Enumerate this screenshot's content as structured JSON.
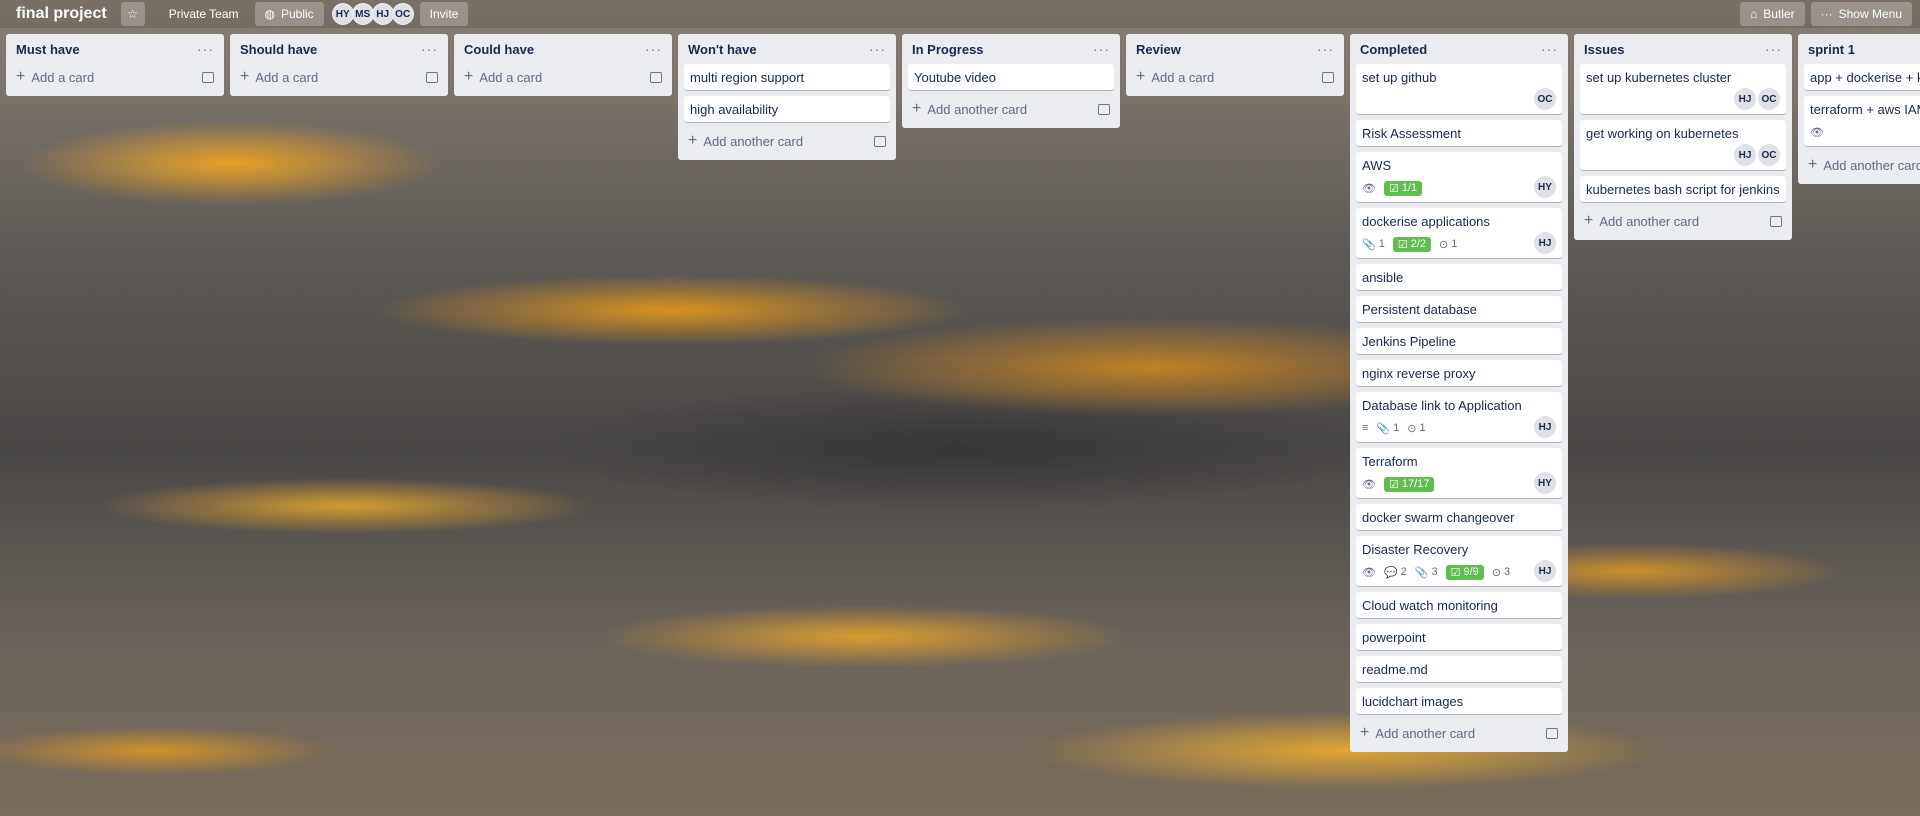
{
  "header": {
    "board_title": "final project",
    "star_icon": "star-icon",
    "team_label": "Private Team",
    "visibility_label": "Public",
    "members": [
      "HY",
      "MS",
      "HJ",
      "OC"
    ],
    "invite_label": "Invite",
    "butler_label": "Butler",
    "show_menu_label": "Show Menu"
  },
  "lists": [
    {
      "title": "Must have",
      "cards": [],
      "add_label": "Add a card"
    },
    {
      "title": "Should have",
      "cards": [],
      "add_label": "Add a card"
    },
    {
      "title": "Could have",
      "cards": [],
      "add_label": "Add a card"
    },
    {
      "title": "Won't have",
      "cards": [
        {
          "title": "multi region support"
        },
        {
          "title": "high availability"
        }
      ],
      "add_label": "Add another card"
    },
    {
      "title": "In Progress",
      "cards": [
        {
          "title": "Youtube video"
        }
      ],
      "add_label": "Add another card"
    },
    {
      "title": "Review",
      "cards": [],
      "add_label": "Add a card"
    },
    {
      "title": "Completed",
      "cards": [
        {
          "title": "set up github",
          "members": [
            "OC"
          ]
        },
        {
          "title": "Risk Assessment"
        },
        {
          "title": "AWS",
          "watch": true,
          "checklist": "1/1",
          "members": [
            "HY"
          ]
        },
        {
          "title": "dockerise applications",
          "attachments": "1",
          "checklist": "2/2",
          "github": "1",
          "members": [
            "HJ"
          ]
        },
        {
          "title": "ansible"
        },
        {
          "title": "Persistent database"
        },
        {
          "title": "Jenkins Pipeline"
        },
        {
          "title": "nginx reverse proxy"
        },
        {
          "title": "Database link to Application",
          "description": true,
          "attachments": "1",
          "github": "1",
          "members": [
            "HJ"
          ]
        },
        {
          "title": "Terraform",
          "watch": true,
          "checklist": "17/17",
          "members": [
            "HY"
          ]
        },
        {
          "title": "docker swarm changeover"
        },
        {
          "title": "Disaster Recovery",
          "watch": true,
          "comments": "2",
          "attachments": "3",
          "checklist": "9/9",
          "github": "3",
          "members": [
            "HJ"
          ]
        },
        {
          "title": "Cloud watch monitoring"
        },
        {
          "title": "powerpoint"
        },
        {
          "title": "readme.md"
        },
        {
          "title": "lucidchart images"
        }
      ],
      "add_label": "Add another card"
    },
    {
      "title": "Issues",
      "cards": [
        {
          "title": "set up kubernetes cluster",
          "members": [
            "HJ",
            "OC"
          ]
        },
        {
          "title": "get working on kubernetes",
          "members": [
            "HJ",
            "OC"
          ]
        },
        {
          "title": "kubernetes bash script for jenkins"
        }
      ],
      "add_label": "Add another card"
    },
    {
      "title": "sprint 1",
      "cards": [
        {
          "title": "app + dockerise + ku"
        },
        {
          "title": "terraform + aws IAM",
          "watch": true
        }
      ],
      "add_label": "Add another card"
    }
  ]
}
